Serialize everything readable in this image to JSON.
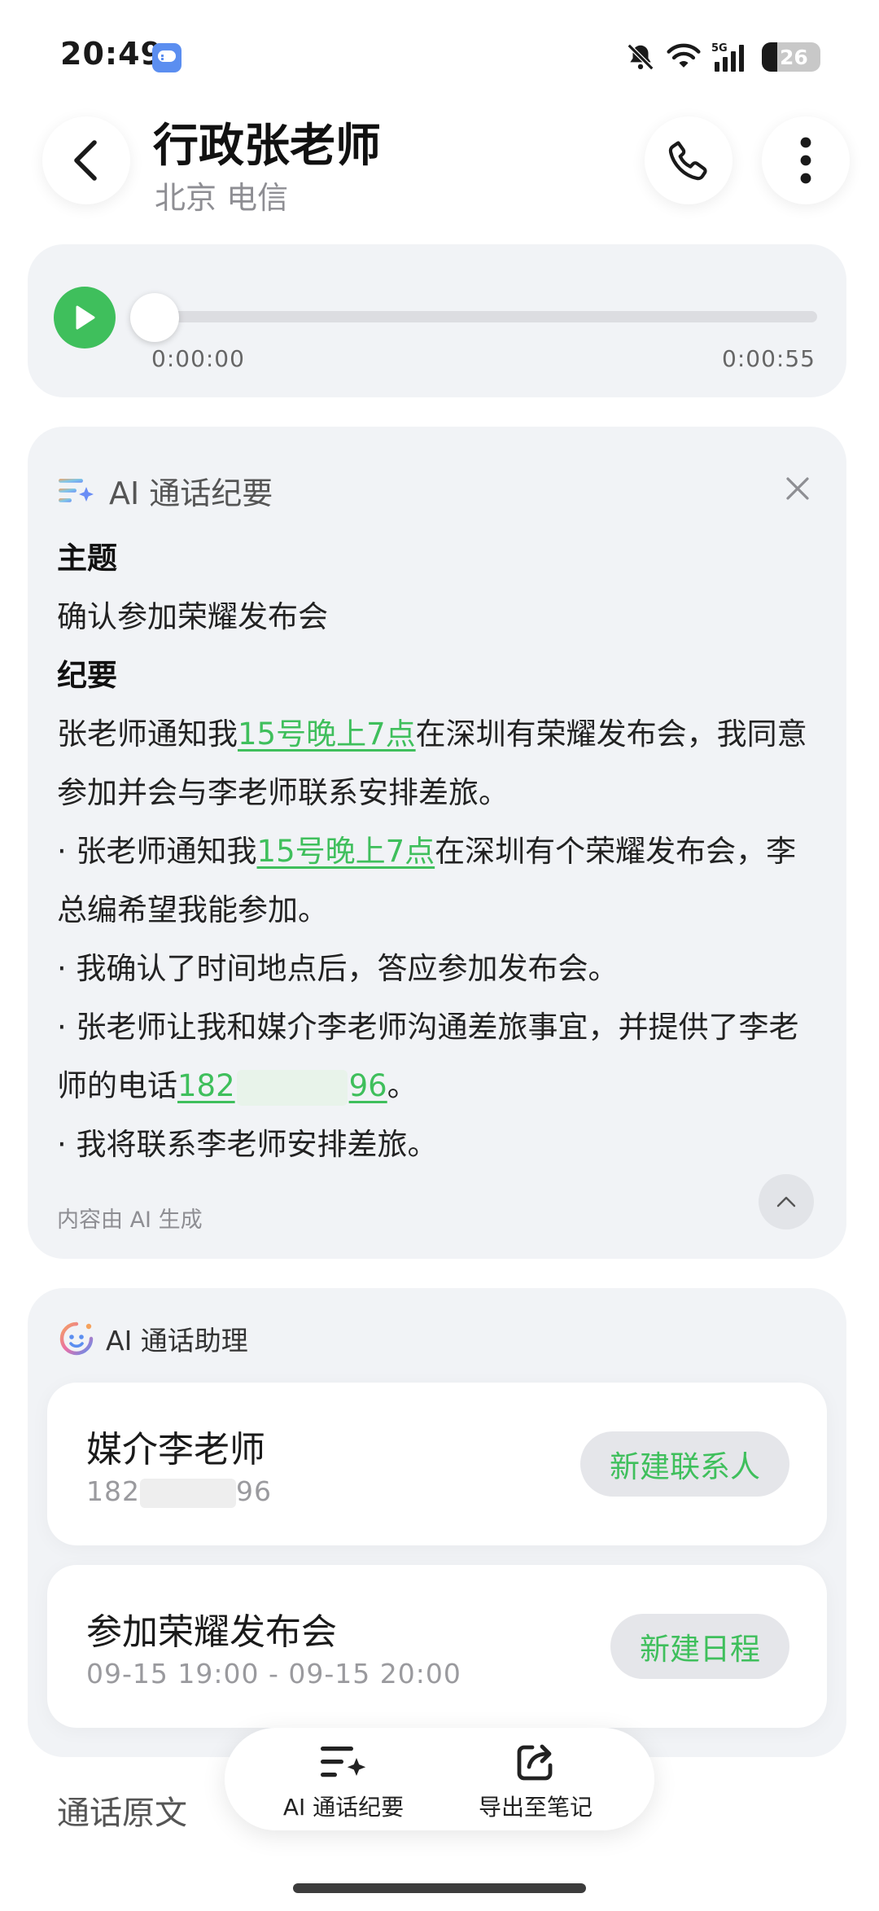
{
  "status_bar": {
    "time": "20:49",
    "network": "5G",
    "battery_level": "26",
    "battery_fraction": 0.26
  },
  "header": {
    "contact_name": "行政张老师",
    "location_carrier": "北京 电信"
  },
  "player": {
    "current_time": "0:00:00",
    "total_time": "0:00:55",
    "progress_fraction": 0.0
  },
  "summary": {
    "title": "AI 通话纪要",
    "topic_heading": "主题",
    "topic_text": "确认参加荣耀发布会",
    "minutes_heading": "纪要",
    "p1_pre": "张老师通知我",
    "p1_link": "15号晚上7点",
    "p1_post": "在深圳有荣耀发布会，我同意参加并会与李老师联系安排差旅。",
    "b1_pre": "· 张老师通知我",
    "b1_link": "15号晚上7点",
    "b1_post": "在深圳有个荣耀发布会，李总编希望我能参加。",
    "b2": "· 我确认了时间地点后，答应参加发布会。",
    "b3_pre": "· 张老师让我和媒介李老师沟通差旅事宜，并提供了李老师的电话",
    "b3_phone_start": "182",
    "b3_phone_end": "96",
    "b3_post": "。",
    "b4": "· 我将联系李老师安排差旅。",
    "ai_note": "内容由 AI 生成"
  },
  "assistant": {
    "title": "AI 通话助理",
    "contact": {
      "name": "媒介李老师",
      "phone_start": "182",
      "phone_end": "96",
      "action": "新建联系人"
    },
    "event": {
      "title": "参加荣耀发布会",
      "time": "09-15 19:00 - 09-15 20:00",
      "action": "新建日程"
    }
  },
  "transcript_label": "通话原文",
  "bottom_bar": {
    "summary_label": "AI 通话纪要",
    "export_label": "导出至笔记"
  },
  "colors": {
    "accent_green": "#3fbf5c",
    "card_bg": "#f1f3f6",
    "muted_text": "#8e8e93"
  }
}
